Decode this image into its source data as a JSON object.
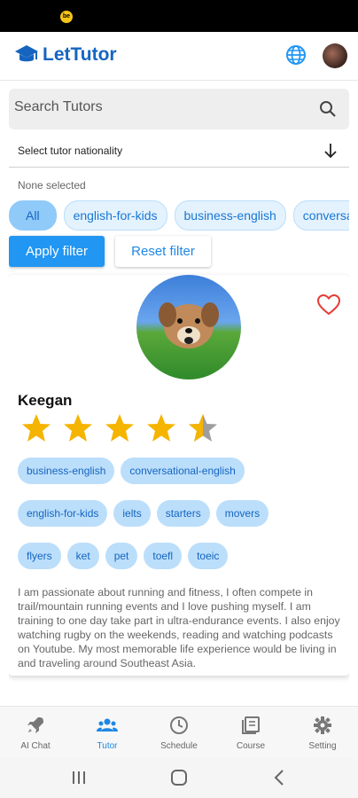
{
  "app": {
    "title": "LetTutor"
  },
  "search": {
    "placeholder": "Search Tutors"
  },
  "filter": {
    "nationality_label": "Select tutor nationality",
    "selection_status": "None selected",
    "chips": [
      "All",
      "english-for-kids",
      "business-english",
      "conversational-english"
    ],
    "active_chip": "All",
    "apply_label": "Apply filter",
    "reset_label": "Reset filter"
  },
  "tutor": {
    "name": "Keegan",
    "rating": 4.5,
    "favorite": false,
    "tags_rows": [
      [
        "business-english",
        "conversational-english"
      ],
      [
        "english-for-kids",
        "ielts",
        "starters",
        "movers"
      ],
      [
        "flyers",
        "ket",
        "pet",
        "toefl",
        "toeic"
      ]
    ],
    "bio": "I am passionate about running and fitness, I often compete in trail/mountain running events and I love pushing myself. I am training to one day take part in ultra-endurance events. I also enjoy watching rugby on the weekends, reading and watching podcasts on Youtube. My most memorable life experience would be living in and traveling around Southeast Asia."
  },
  "bottom_nav": [
    {
      "label": "AI Chat",
      "icon": "rocket-icon"
    },
    {
      "label": "Tutor",
      "icon": "people-icon",
      "active": true
    },
    {
      "label": "Schedule",
      "icon": "clock-icon"
    },
    {
      "label": "Course",
      "icon": "book-icon"
    },
    {
      "label": "Setting",
      "icon": "gear-icon"
    }
  ],
  "colors": {
    "primary": "#2196f3",
    "brand": "#1565c0",
    "heart": "#e53935",
    "star": "#f5b400"
  }
}
